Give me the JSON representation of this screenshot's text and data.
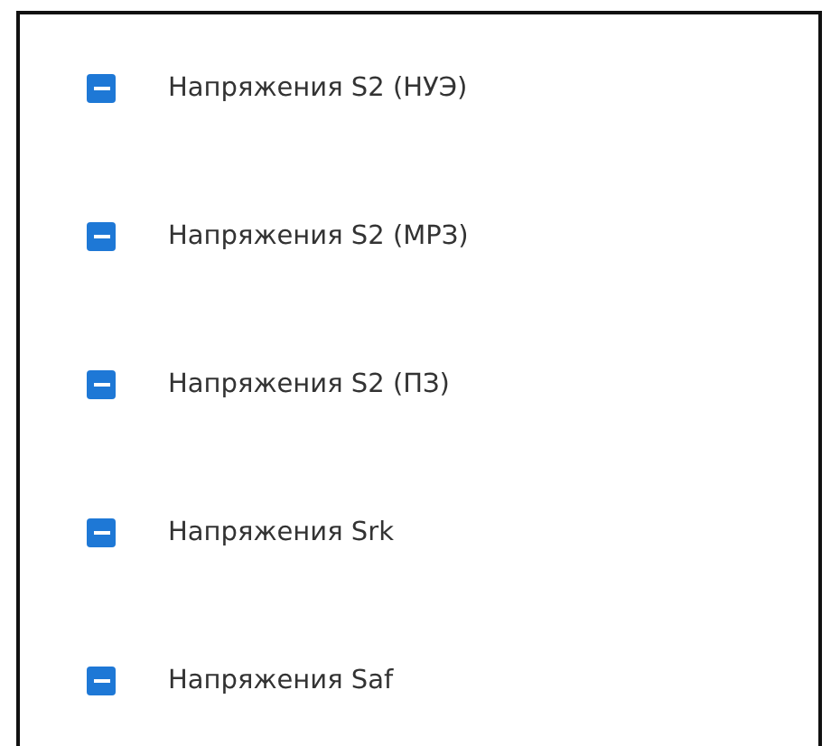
{
  "items": [
    {
      "label": "Напряжения S2 (НУЭ)",
      "indeterminate": true
    },
    {
      "label": "Напряжения S2 (МРЗ)",
      "indeterminate": true
    },
    {
      "label": "Напряжения S2 (ПЗ)",
      "indeterminate": true
    },
    {
      "label": "Напряжения Srk",
      "indeterminate": true
    },
    {
      "label": "Напряжения Saf",
      "indeterminate": true
    }
  ]
}
